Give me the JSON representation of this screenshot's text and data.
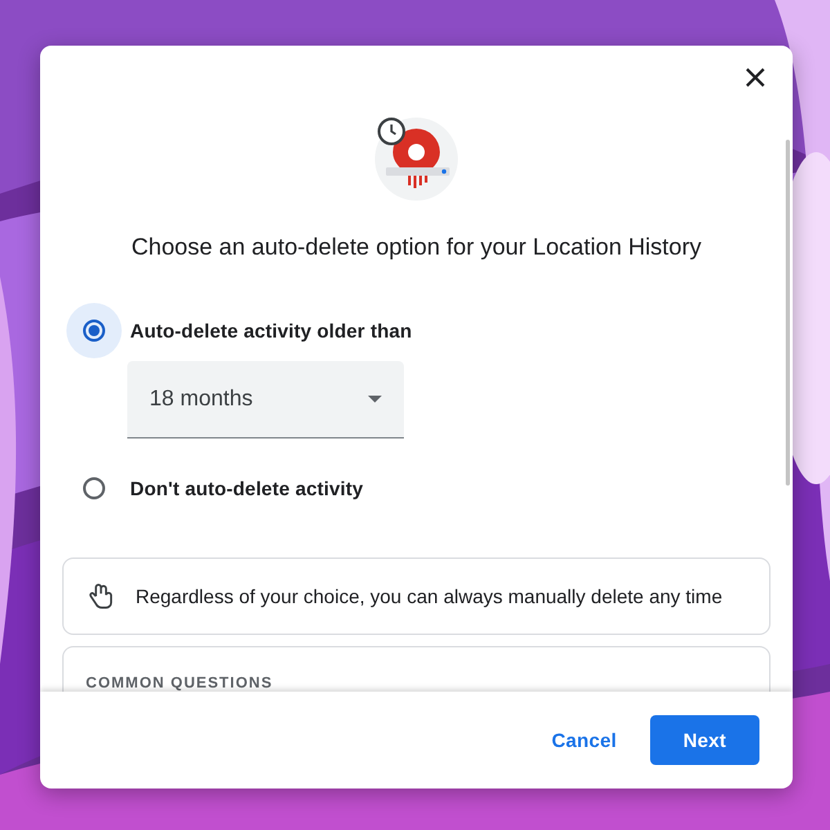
{
  "dialog": {
    "title": "Choose an auto-delete option for your Location History",
    "options": [
      {
        "label": "Auto-delete activity older than",
        "selected": true,
        "dropdown": {
          "value": "18 months"
        }
      },
      {
        "label": "Don't auto-delete activity",
        "selected": false
      }
    ],
    "info": {
      "text": "Regardless of your choice, you can always manually delete any time"
    },
    "questions": {
      "heading": "COMMON QUESTIONS"
    },
    "buttons": [
      {
        "label": "Cancel",
        "kind": "text"
      },
      {
        "label": "Next",
        "kind": "primary"
      }
    ]
  }
}
